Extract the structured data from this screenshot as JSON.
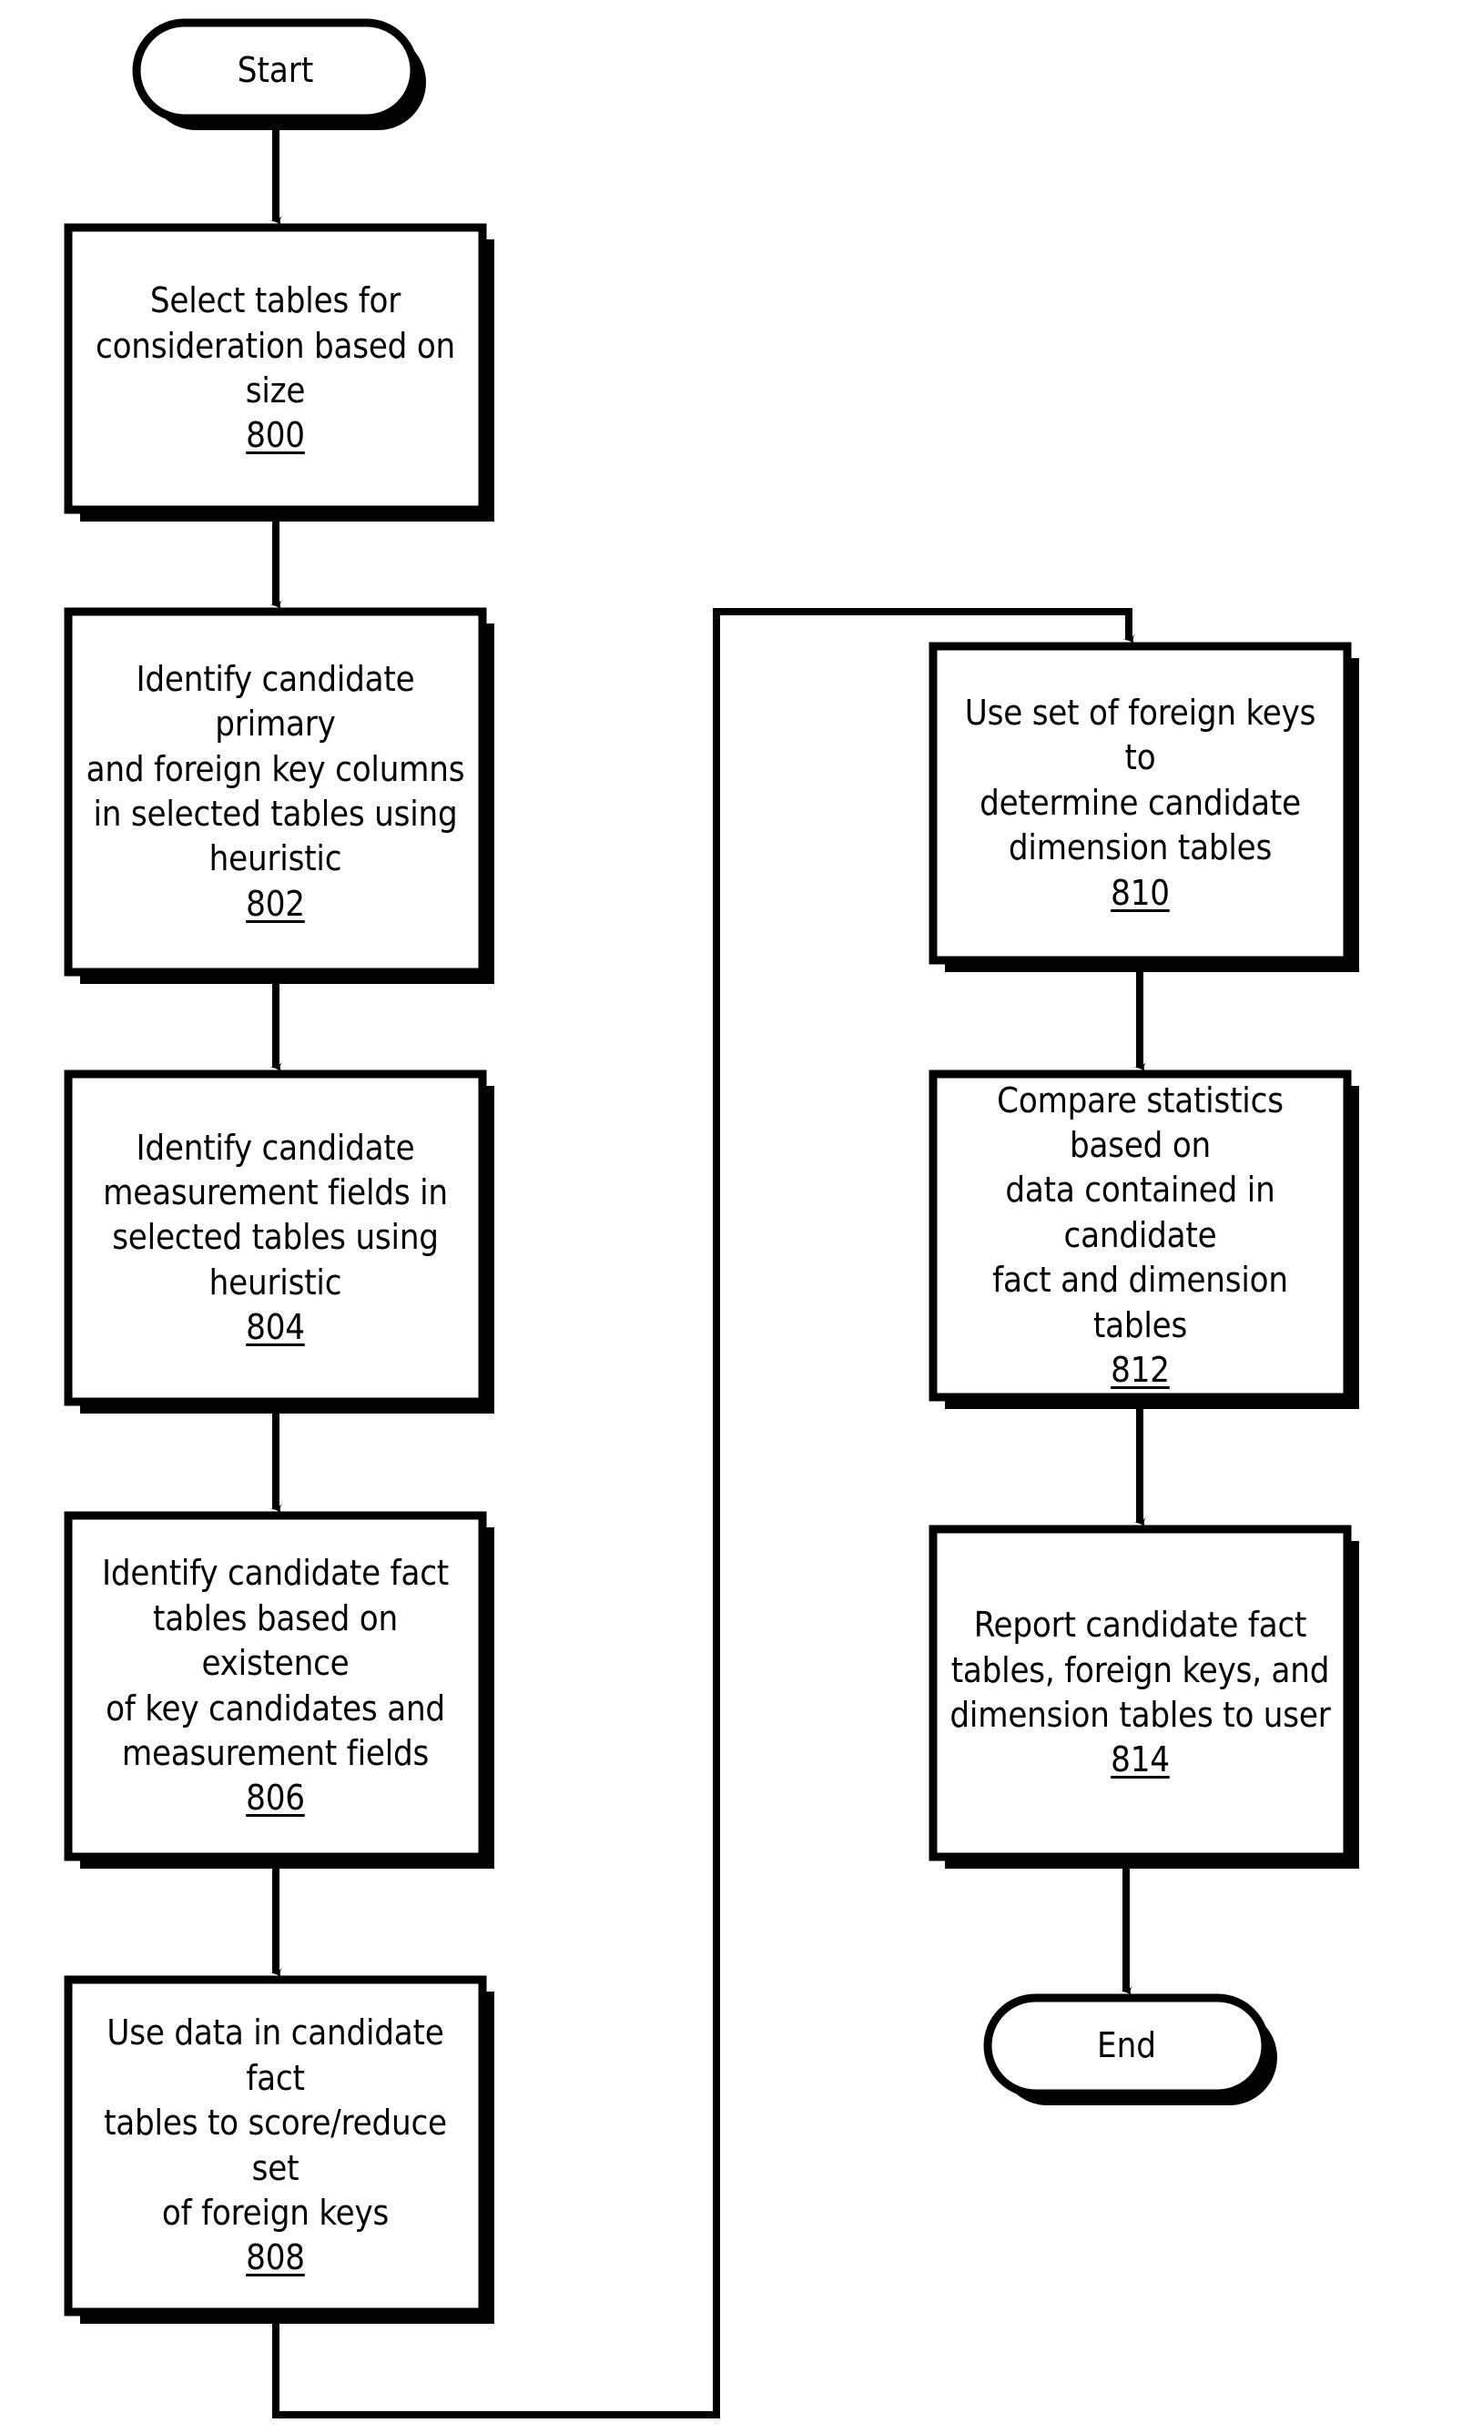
{
  "diagram": {
    "title": "Fact and dimension table discovery flowchart",
    "colors": {
      "stroke": "#000000",
      "fill": "#ffffff",
      "shadow": "#000000",
      "text": "#000000"
    },
    "start": {
      "label": "Start"
    },
    "end": {
      "label": "End"
    },
    "nodes": [
      {
        "id": "800",
        "ref": "800",
        "lines": [
          "Select tables for",
          "consideration based on",
          "size"
        ],
        "column": "left"
      },
      {
        "id": "802",
        "ref": "802",
        "lines": [
          "Identify candidate primary",
          "and foreign key columns",
          "in selected tables using",
          "heuristic"
        ],
        "column": "left"
      },
      {
        "id": "804",
        "ref": "804",
        "lines": [
          "Identify candidate",
          "measurement fields in",
          "selected tables using",
          "heuristic"
        ],
        "column": "left"
      },
      {
        "id": "806",
        "ref": "806",
        "lines": [
          "Identify candidate fact",
          "tables based on existence",
          "of key candidates and",
          "measurement fields"
        ],
        "column": "left"
      },
      {
        "id": "808",
        "ref": "808",
        "lines": [
          "Use data in candidate fact",
          "tables to score/reduce set",
          "of foreign keys"
        ],
        "column": "left"
      },
      {
        "id": "810",
        "ref": "810",
        "lines": [
          "Use set of foreign keys to",
          "determine candidate",
          "dimension tables"
        ],
        "column": "right"
      },
      {
        "id": "812",
        "ref": "812",
        "lines": [
          "Compare statistics based on",
          "data contained in candidate",
          "fact and dimension tables"
        ],
        "column": "right"
      },
      {
        "id": "814",
        "ref": "814",
        "lines": [
          "Report candidate fact",
          "tables, foreign keys, and",
          "dimension tables to user"
        ],
        "column": "right"
      }
    ],
    "edges": [
      {
        "from": "start",
        "to": "800",
        "kind": "straight-down"
      },
      {
        "from": "800",
        "to": "802",
        "kind": "straight-down"
      },
      {
        "from": "802",
        "to": "804",
        "kind": "straight-down"
      },
      {
        "from": "804",
        "to": "806",
        "kind": "straight-down"
      },
      {
        "from": "806",
        "to": "808",
        "kind": "straight-down"
      },
      {
        "from": "808",
        "to": "810",
        "kind": "wrap-around-bottom-left-to-top-right"
      },
      {
        "from": "810",
        "to": "812",
        "kind": "straight-down"
      },
      {
        "from": "812",
        "to": "814",
        "kind": "straight-down"
      },
      {
        "from": "814",
        "to": "end",
        "kind": "straight-down"
      }
    ]
  }
}
